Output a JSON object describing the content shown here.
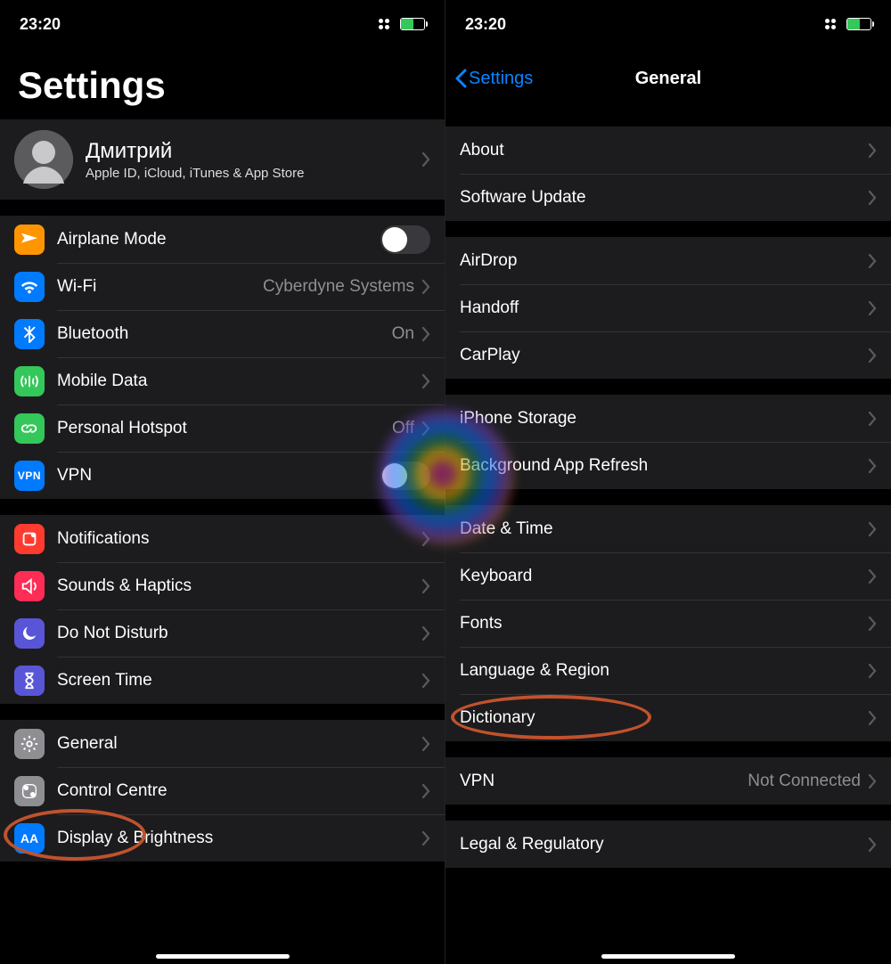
{
  "status": {
    "time": "23:20"
  },
  "left": {
    "title": "Settings",
    "profile": {
      "name": "Дмитрий",
      "subtitle": "Apple ID, iCloud, iTunes & App Store"
    },
    "group_network": {
      "airplane": "Airplane Mode",
      "wifi": "Wi-Fi",
      "wifi_value": "Cyberdyne Systems",
      "bluetooth": "Bluetooth",
      "bluetooth_value": "On",
      "mobiledata": "Mobile Data",
      "hotspot": "Personal Hotspot",
      "hotspot_value": "Off",
      "vpn": "VPN"
    },
    "group_alerts": {
      "notifications": "Notifications",
      "sounds": "Sounds & Haptics",
      "dnd": "Do Not Disturb",
      "screentime": "Screen Time"
    },
    "group_system": {
      "general": "General",
      "control": "Control Centre",
      "display": "Display & Brightness"
    }
  },
  "right": {
    "back": "Settings",
    "title": "General",
    "g1": {
      "about": "About",
      "software": "Software Update"
    },
    "g2": {
      "airdrop": "AirDrop",
      "handoff": "Handoff",
      "carplay": "CarPlay"
    },
    "g3": {
      "storage": "iPhone Storage",
      "bgrefresh": "Background App Refresh"
    },
    "g4": {
      "datetime": "Date & Time",
      "keyboard": "Keyboard",
      "fonts": "Fonts",
      "lang": "Language & Region",
      "dict": "Dictionary"
    },
    "g5": {
      "vpn": "VPN",
      "vpn_value": "Not Connected"
    },
    "g6": {
      "legal": "Legal & Regulatory"
    }
  }
}
